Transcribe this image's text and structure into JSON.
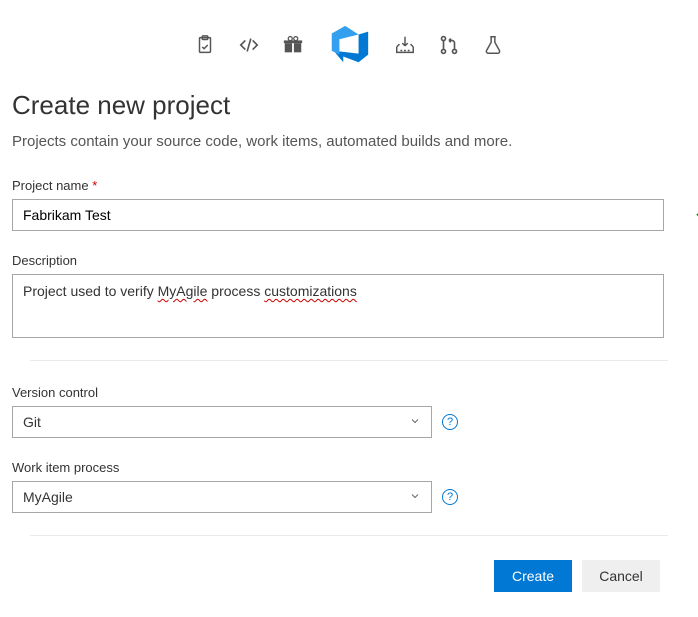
{
  "icons": [
    "clipboard",
    "code",
    "gift",
    "devops",
    "download-box",
    "pull-request",
    "flask"
  ],
  "heading": "Create new project",
  "subtitle": "Projects contain your source code, work items, automated builds and more.",
  "fields": {
    "project_name": {
      "label": "Project name",
      "required_mark": "*",
      "value": "Fabrikam Test",
      "validated": true
    },
    "description": {
      "label": "Description",
      "value_parts": [
        "Project used to verify ",
        "MyAgile",
        " process ",
        "customizations"
      ]
    },
    "version_control": {
      "label": "Version control",
      "value": "Git"
    },
    "work_item_process": {
      "label": "Work item process",
      "value": "MyAgile"
    }
  },
  "help_glyph": "?",
  "buttons": {
    "create": "Create",
    "cancel": "Cancel"
  }
}
